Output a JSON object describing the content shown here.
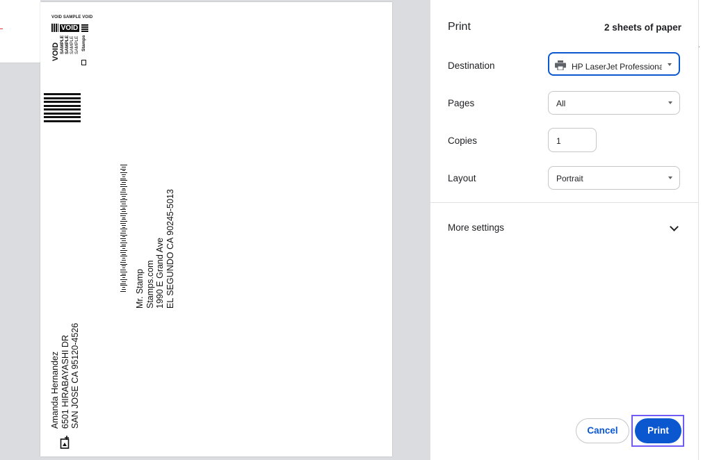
{
  "preview": {
    "indicia": {
      "header": "VOID SAMPLE VOID",
      "void_badge": "VOID",
      "void_vertical": "VOID",
      "sample_lines": [
        "SAMPLE",
        "SAMPLE",
        "SAMPLE",
        "SAMPLE"
      ],
      "brand": "Stamps"
    },
    "return_address": [
      "Mr. Stamp",
      "Stamps.com",
      "1990 E Grand Ave",
      "EL SEGUNDO CA 90245-5013"
    ],
    "recipient_address": [
      "Amanda Hernandez",
      "6501 HIRABAYASHI DR",
      "SAN JOSE CA 95120-4526"
    ]
  },
  "panel": {
    "title": "Print",
    "sheet_count": "2 sheets of paper",
    "destination": {
      "label": "Destination",
      "value": "HP LaserJet Professional",
      "icon": "printer-icon"
    },
    "pages": {
      "label": "Pages",
      "value": "All"
    },
    "copies": {
      "label": "Copies",
      "value": "1"
    },
    "layout": {
      "label": "Layout",
      "value": "Portrait"
    },
    "more_settings": {
      "label": "More settings",
      "icon": "chevron-down-icon"
    },
    "buttons": {
      "cancel": "Cancel",
      "print": "Print"
    },
    "accent_color": "#0b57d0",
    "focus_color": "#6f5cf5"
  }
}
